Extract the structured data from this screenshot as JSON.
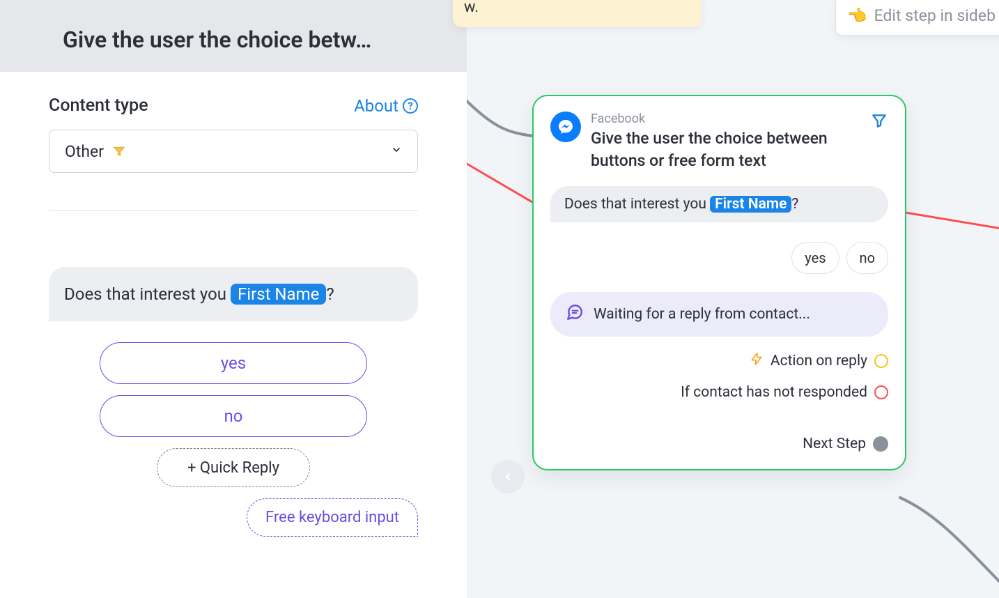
{
  "sidebar": {
    "title": "Give the user the choice betw…",
    "content_type_label": "Content type",
    "about_label": "About",
    "select_value": "Other",
    "message_prefix": "Does that interest you ",
    "message_tag": "First Name",
    "message_suffix": "?",
    "quick_replies": [
      "yes",
      "no"
    ],
    "add_quick_reply_label": "+ Quick Reply",
    "free_keyboard_label": "Free keyboard input"
  },
  "canvas": {
    "top_note_suffix": "w.",
    "edit_step_label": "Edit step in sideb",
    "node": {
      "channel": "Facebook",
      "title": "Give the user the choice between buttons or free form text",
      "message_prefix": "Does that interest you ",
      "message_tag": "First Name",
      "message_suffix": "?",
      "pills": [
        "yes",
        "no"
      ],
      "waiting_text": "Waiting for a reply from contact...",
      "action_on_reply": "Action on reply",
      "not_responded": "If contact has not responded",
      "next_step": "Next Step"
    }
  }
}
